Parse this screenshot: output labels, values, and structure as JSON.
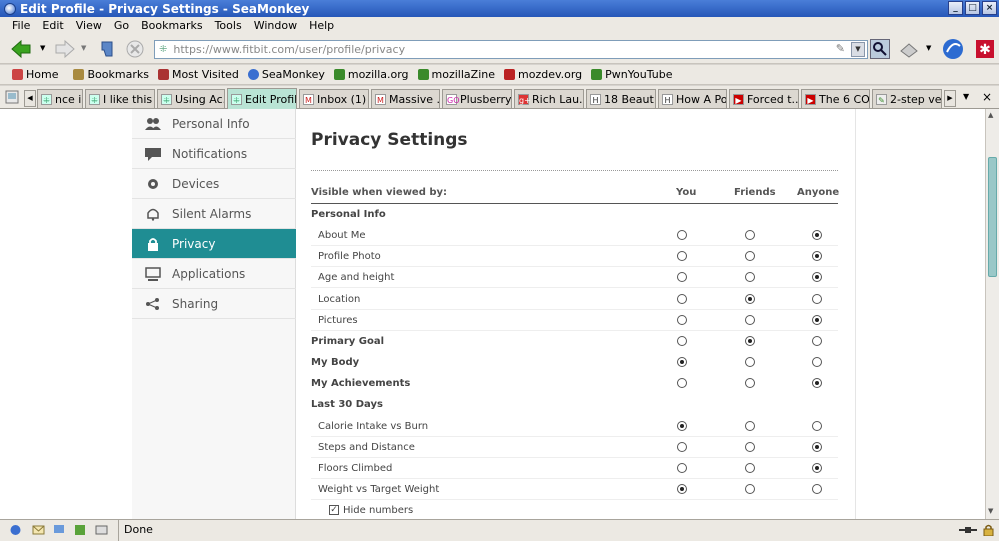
{
  "window": {
    "title": "Edit Profile - Privacy Settings - SeaMonkey"
  },
  "menu": [
    "File",
    "Edit",
    "View",
    "Go",
    "Bookmarks",
    "Tools",
    "Window",
    "Help"
  ],
  "urlbar": {
    "value": "https://www.fitbit.com/user/profile/privacy"
  },
  "bookmarks": [
    "Home",
    "Bookmarks",
    "Most Visited",
    "SeaMonkey",
    "mozilla.org",
    "mozillaZine",
    "mozdev.org",
    "PwnYouTube"
  ],
  "tabs": [
    {
      "label": "nce i ha...",
      "icon": "blank"
    },
    {
      "label": "I like this ...",
      "icon": "blank"
    },
    {
      "label": "Using Ac...",
      "icon": "blank"
    },
    {
      "label": "Edit Profil...",
      "icon": "blank"
    },
    {
      "label": "Inbox (1) ...",
      "icon": "gmail"
    },
    {
      "label": "Massive ...",
      "icon": "gmail"
    },
    {
      "label": "Plusberry....",
      "icon": "go"
    },
    {
      "label": "Rich Lau...",
      "icon": "gplus"
    },
    {
      "label": "18 Beaut...",
      "icon": "h"
    },
    {
      "label": "How A Po...",
      "icon": "h"
    },
    {
      "label": "Forced t...",
      "icon": "youtube"
    },
    {
      "label": "The 6 CO...",
      "icon": "youtube"
    },
    {
      "label": "2-step ve...",
      "icon": "leaf"
    }
  ],
  "sidebar": [
    {
      "label": "Personal Info",
      "icon": "people-icon"
    },
    {
      "label": "Notifications",
      "icon": "speech-bubble-icon"
    },
    {
      "label": "Devices",
      "icon": "gear-icon"
    },
    {
      "label": "Silent Alarms",
      "icon": "bell-icon"
    },
    {
      "label": "Privacy",
      "icon": "lock-icon",
      "active": true
    },
    {
      "label": "Applications",
      "icon": "monitor-icon"
    },
    {
      "label": "Sharing",
      "icon": "share-icon"
    }
  ],
  "privacy": {
    "title": "Privacy Settings",
    "visible_label": "Visible when viewed by:",
    "columns": [
      "You",
      "Friends",
      "Anyone"
    ],
    "rows": [
      {
        "label": "Personal Info",
        "style": "section"
      },
      {
        "label": "About Me",
        "style": "sub",
        "selected": 2
      },
      {
        "label": "Profile Photo",
        "style": "sub",
        "selected": 2
      },
      {
        "label": "Age and height",
        "style": "sub",
        "selected": 2
      },
      {
        "label": "Location",
        "style": "sub",
        "selected": 1
      },
      {
        "label": "Pictures",
        "style": "sub",
        "selected": 2
      },
      {
        "label": "Primary Goal",
        "style": "bold",
        "selected": 1
      },
      {
        "label": "My Body",
        "style": "bold",
        "selected": 0
      },
      {
        "label": "My Achievements",
        "style": "bold",
        "selected": 2
      },
      {
        "label": "Last 30 Days",
        "style": "section"
      },
      {
        "label": "Calorie Intake vs Burn",
        "style": "sub",
        "selected": 0
      },
      {
        "label": "Steps and Distance",
        "style": "sub",
        "selected": 2
      },
      {
        "label": "Floors Climbed",
        "style": "sub",
        "selected": 2
      },
      {
        "label": "Weight vs Target Weight",
        "style": "sub",
        "selected": 0
      }
    ],
    "hide_numbers": {
      "label": "Hide numbers",
      "checked": true
    }
  },
  "status": {
    "text": "Done"
  }
}
